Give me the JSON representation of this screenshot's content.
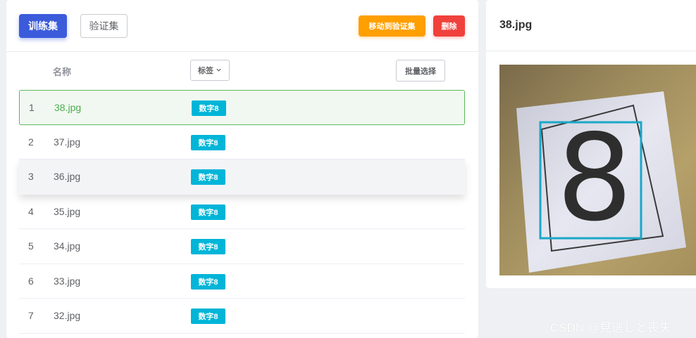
{
  "toolbar": {
    "train_label": "训练集",
    "val_label": "验证集",
    "move_label": "移动到验证集",
    "delete_label": "删除"
  },
  "table_header": {
    "name_col": "名称",
    "tag_filter": "标签",
    "batch_select": "批量选择"
  },
  "rows": [
    {
      "index": "1",
      "name": "38.jpg",
      "tag": "数字8"
    },
    {
      "index": "2",
      "name": "37.jpg",
      "tag": "数字8"
    },
    {
      "index": "3",
      "name": "36.jpg",
      "tag": "数字8"
    },
    {
      "index": "4",
      "name": "35.jpg",
      "tag": "数字8"
    },
    {
      "index": "5",
      "name": "34.jpg",
      "tag": "数字8"
    },
    {
      "index": "6",
      "name": "33.jpg",
      "tag": "数字8"
    },
    {
      "index": "7",
      "name": "32.jpg",
      "tag": "数字8"
    }
  ],
  "preview": {
    "title": "38.jpg",
    "digit": "8"
  },
  "watermark": "CSDN @見逃しと喪失",
  "colors": {
    "primary": "#3b5bdb",
    "warning": "#ff9f00",
    "danger": "#f0413c",
    "tag": "#00b5d8",
    "selected_border": "#5cb85c",
    "bbox": "#1aa7c9"
  },
  "icons": {
    "tag_filter": "chevron-down-icon"
  }
}
